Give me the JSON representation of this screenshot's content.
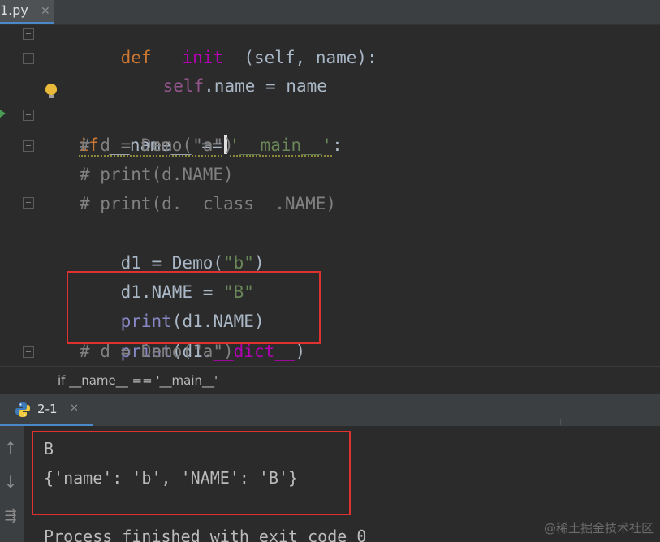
{
  "editor_tab": {
    "label": "1.py"
  },
  "code": {
    "line_init": {
      "kw": "def",
      "name": "__init__",
      "rest": "(self, name):"
    },
    "line_assign": {
      "self": "self",
      "rest": ".name = name"
    },
    "line_if": {
      "kw": "if",
      "name": "__name__",
      "op": "==",
      "str": "'__main__'",
      "colon": ":"
    },
    "comment_1": "# d = Demo(\"a\")",
    "comment_2": "# print(d.NAME)",
    "comment_3": "# print(d.__class__.NAME)",
    "line_d1": {
      "pre": "d1 = Demo(",
      "str": "\"b\"",
      "post": ")"
    },
    "line_d1_name": {
      "pre": "d1.NAME = ",
      "str": "\"B\""
    },
    "line_print1": {
      "fn": "print",
      "rest": "(d1.NAME)"
    },
    "line_print2": {
      "fn": "print",
      "pre": "(d1.",
      "dunder": "__dict__",
      "post": ")"
    },
    "comment_4": "# d = Demo(\"a\")"
  },
  "breadcrumb": "if __name__ == '__main__'",
  "run_panel": {
    "tab_label": "2-1",
    "close_glyph": "✕",
    "output": [
      "B",
      "{'name': 'b', 'NAME': 'B'}",
      "",
      "Process finished with exit code 0"
    ]
  },
  "icons": {
    "run_gutter": "run-arrow-icon",
    "bulb": "lightbulb-icon",
    "python": "python-logo-icon",
    "up": "arrow-up-icon",
    "down": "arrow-down-icon",
    "wrap": "soft-wrap-icon"
  },
  "watermark": "@稀土掘金技术社区",
  "colors": {
    "highlight": "#e03131",
    "keyword": "#cc7832",
    "string": "#6a8759",
    "comment": "#808080",
    "self": "#94558d",
    "builtin": "#8888c6",
    "dunder": "#b200b2",
    "accent": "#4a88c7"
  }
}
